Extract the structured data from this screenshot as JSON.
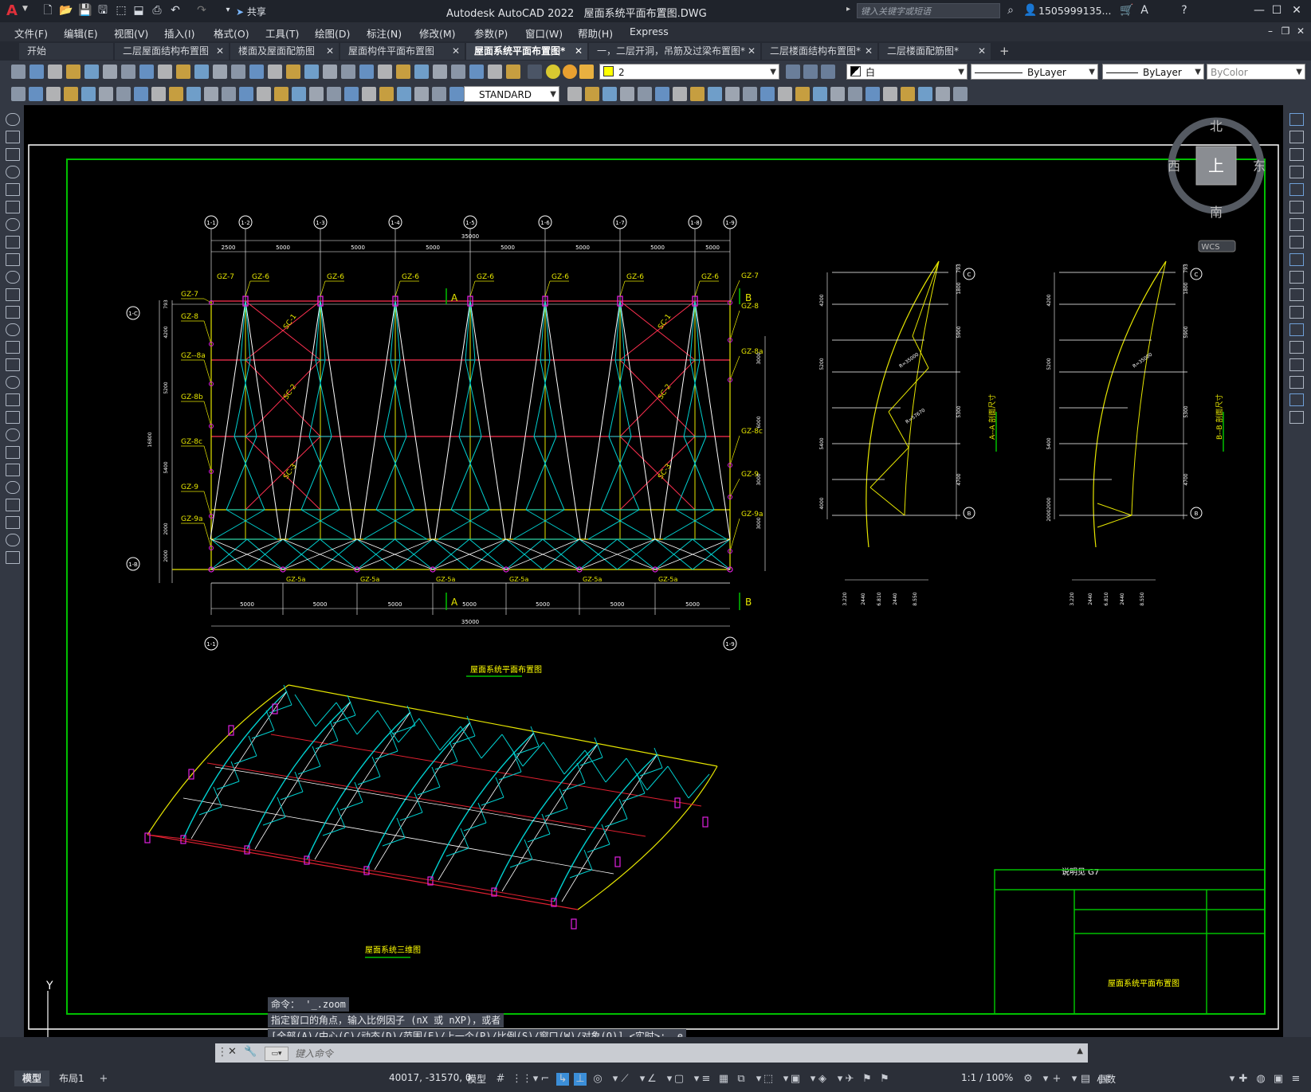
{
  "app": {
    "title": "Autodesk AutoCAD 2022",
    "file": "屋面系统平面布置图.DWG",
    "share_label": "共享",
    "search_placeholder": "键入关键字或短语",
    "user": "1505999135...",
    "logo": "A"
  },
  "menu": [
    "文件(F)",
    "编辑(E)",
    "视图(V)",
    "插入(I)",
    "格式(O)",
    "工具(T)",
    "绘图(D)",
    "标注(N)",
    "修改(M)",
    "参数(P)",
    "窗口(W)",
    "帮助(H)",
    "Express"
  ],
  "tabs": [
    {
      "label": "开始",
      "active": false,
      "close": false
    },
    {
      "label": "二层屋面结构布置图",
      "active": false,
      "close": true
    },
    {
      "label": "楼面及屋面配筋图",
      "active": false,
      "close": true
    },
    {
      "label": "屋面构件平面布置图",
      "active": false,
      "close": true
    },
    {
      "label": "屋面系统平面布置图*",
      "active": true,
      "close": true
    },
    {
      "label": "一，二层开洞，吊筋及过梁布置图*",
      "active": false,
      "close": true
    },
    {
      "label": "二层楼面结构布置图*",
      "active": false,
      "close": true
    },
    {
      "label": "二层楼面配筋图*",
      "active": false,
      "close": true
    }
  ],
  "properties": {
    "layer": "2",
    "color": "白",
    "linetype": "ByLayer",
    "lineweight": "ByLayer",
    "plotstyle": "ByColor",
    "textstyle": "STANDARD"
  },
  "viewcube": {
    "north": "北",
    "south": "南",
    "east": "东",
    "west": "西",
    "top": "上",
    "wcs": "WCS"
  },
  "drawing": {
    "plan_title": "屋面系统平面布置图",
    "iso_title": "屋面系统三维图",
    "note": "说明见 G7",
    "titleblock_name": "屋面系统平面布置图",
    "overall_dim": "35000",
    "top_dims": [
      "2500",
      "5000",
      "5000",
      "5000",
      "5000",
      "5000",
      "5000",
      "5000",
      "2500"
    ],
    "bottom_dims": [
      "5000",
      "5000",
      "5000",
      "5000",
      "5000",
      "5000",
      "5000"
    ],
    "grid_top": [
      "1-1",
      "1-2",
      "1-3",
      "1-4",
      "1-5",
      "1-6",
      "1-7",
      "1-8",
      "1-9"
    ],
    "grid_bottom": [
      "1-1",
      "1-9"
    ],
    "grid_left": [
      "1-C",
      "1-B"
    ],
    "left_dims": [
      "793",
      "4200",
      "5200",
      "5400",
      "2000",
      "2000"
    ],
    "left_total": "16800",
    "gz_left": [
      "GZ-7",
      "GZ-8",
      "GZ--8a",
      "GZ-8b",
      "GZ-8c",
      "GZ-9",
      "GZ-9a"
    ],
    "gz_right": [
      "GZ-7",
      "GZ-8",
      "GZ-8a",
      "GZ-8c",
      "GZ-9",
      "GZ-9a"
    ],
    "gz_top": "GZ-6",
    "gz_bottom": "GZ-5a",
    "right_dims": [
      "3000",
      "6000",
      "3000",
      "3000"
    ],
    "sc": [
      "SC-1",
      "SC-2",
      "SC-3"
    ],
    "section_a": "A",
    "section_b": "B",
    "section_aa": "A--A 剖面尺寸",
    "section_bb": "B--B 剖面尺寸",
    "aa_left_dims": [
      "4200",
      "5200",
      "5400",
      "4000"
    ],
    "aa_right_dims": [
      "793",
      "1800",
      "5900",
      "5300",
      "4700"
    ],
    "aa_radius1": "R=35000",
    "aa_radius2": "R=57670",
    "aa_bottom_dims": [
      "3.220",
      "2440",
      "6.810",
      "2440",
      "8.550"
    ],
    "bb_left_dims": [
      "4200",
      "5200",
      "5400",
      "2000",
      "2000"
    ],
    "bb_right_dims": [
      "793",
      "1800",
      "5900",
      "5300",
      "4700"
    ],
    "bb_radius": "R=35000",
    "bb_bottom_dims": [
      "3.220",
      "2440",
      "6.810",
      "2440",
      "8.550"
    ],
    "grid_c": "C",
    "grid_b": "B"
  },
  "command": {
    "history": [
      "命令： '_.zoom",
      "指定窗口的角点，输入比例因子 (nX 或 nXP)，或者",
      "[全部(A)/中心(C)/动态(D)/范围(E)/上一个(P)/比例(S)/窗口(W)/对象(O)] <实时>: _e"
    ],
    "placeholder": "键入命令"
  },
  "status": {
    "coords": "40017, -31570, 0",
    "model_btn": "模型",
    "scale": "1:1 / 100%",
    "units": "小数",
    "layout_tabs": [
      "模型",
      "布局1"
    ]
  },
  "colors": {
    "accent": "#3b8ed8",
    "cyan": "#00d0d0",
    "yellow": "#e6e600",
    "red": "#e02030",
    "magenta": "#e020e0",
    "green": "#00c000"
  }
}
